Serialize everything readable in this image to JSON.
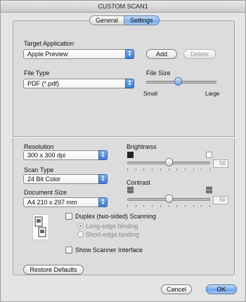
{
  "window": {
    "title": "CUSTOM SCAN1"
  },
  "tabs": [
    {
      "label": "General",
      "active": false
    },
    {
      "label": "Settings",
      "active": true
    }
  ],
  "target_application": {
    "label": "Target Application",
    "selected": "Apple Preview",
    "add_label": "Add",
    "delete_label": "Delete"
  },
  "file_type": {
    "label": "File Type",
    "selected": "PDF (*.pdf)"
  },
  "file_size": {
    "label": "File Size",
    "min_label": "Small",
    "max_label": "Large",
    "level_fraction": 0.45
  },
  "resolution": {
    "label": "Resolution",
    "selected": "300 x 300 dpi"
  },
  "scan_type": {
    "label": "Scan Type",
    "selected": "24 Bit Color"
  },
  "document_size": {
    "label": "Document Size",
    "selected": "A4  210 x 297 mm"
  },
  "brightness": {
    "label": "Brightness",
    "value": "50",
    "level_fraction": 0.5
  },
  "contrast": {
    "label": "Contrast",
    "value": "50",
    "level_fraction": 0.5
  },
  "duplex": {
    "label": "Duplex (two-sided) Scanning",
    "checked": false,
    "options": [
      {
        "label": "Long-edge binding",
        "selected": true
      },
      {
        "label": "Short-edge binding",
        "selected": false
      }
    ]
  },
  "show_scanner_interface": {
    "label": "Show Scanner Interface",
    "checked": false
  },
  "buttons": {
    "restore_defaults": "Restore Defaults",
    "cancel": "Cancel",
    "ok": "OK"
  },
  "colors": {
    "accent_blue": "#6fa6eb",
    "panel_bg": "#dcdcdc",
    "window_bg": "#e4e4e4"
  }
}
